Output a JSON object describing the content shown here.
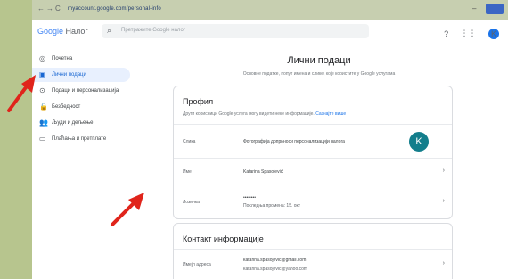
{
  "browser": {
    "nav_back": "←",
    "nav_forward": "→",
    "nav_reload": "C",
    "url": "myaccount.google.com/personal-info",
    "minimize": "–"
  },
  "appbar": {
    "logo_g": "Google",
    "logo_rest": " Налог",
    "search_placeholder": "Претражите Google налог",
    "help_icon": "?",
    "apps_icon": "⋮⋮",
    "account_initial": "K"
  },
  "sidebar": {
    "items": [
      {
        "label": "Почетна",
        "icon": "◎"
      },
      {
        "label": "Лични подаци",
        "icon": "▣"
      },
      {
        "label": "Подаци и персонализација",
        "icon": "⊙"
      },
      {
        "label": "Безбедност",
        "icon": "🔒"
      },
      {
        "label": "Људи и дељење",
        "icon": "👥"
      },
      {
        "label": "Плаћања и претплате",
        "icon": "▭"
      }
    ]
  },
  "main": {
    "title": "Лични подаци",
    "subtitle": "Основне податке, попут имена и слике, које користите у Google услугама",
    "profile": {
      "title": "Профил",
      "desc": "Други корисници Google услуга могу видети неке информације.",
      "desc_link": "Сазнајте више",
      "rows": [
        {
          "label": "Слика",
          "value": "Фотографија доприноси персонализацији налога"
        },
        {
          "label": "Име",
          "value": "Katarina Spasojević"
        },
        {
          "label": "Лозинка",
          "value": "••••••••",
          "value2": "Последња промена: 15. окт"
        }
      ],
      "avatar_initial": "K"
    },
    "contact": {
      "title": "Контакт информације",
      "rows": [
        {
          "label": "Имејл адреса",
          "value": "katarina.spasojevic@gmail.com",
          "value2": "katarina.spasojevic@yahoo.com"
        }
      ]
    },
    "chevron": "›"
  },
  "colors": {
    "accent": "#1a73e8",
    "arrow": "#e0241b",
    "avatar": "#137e8c",
    "background": "#b7c58e"
  }
}
